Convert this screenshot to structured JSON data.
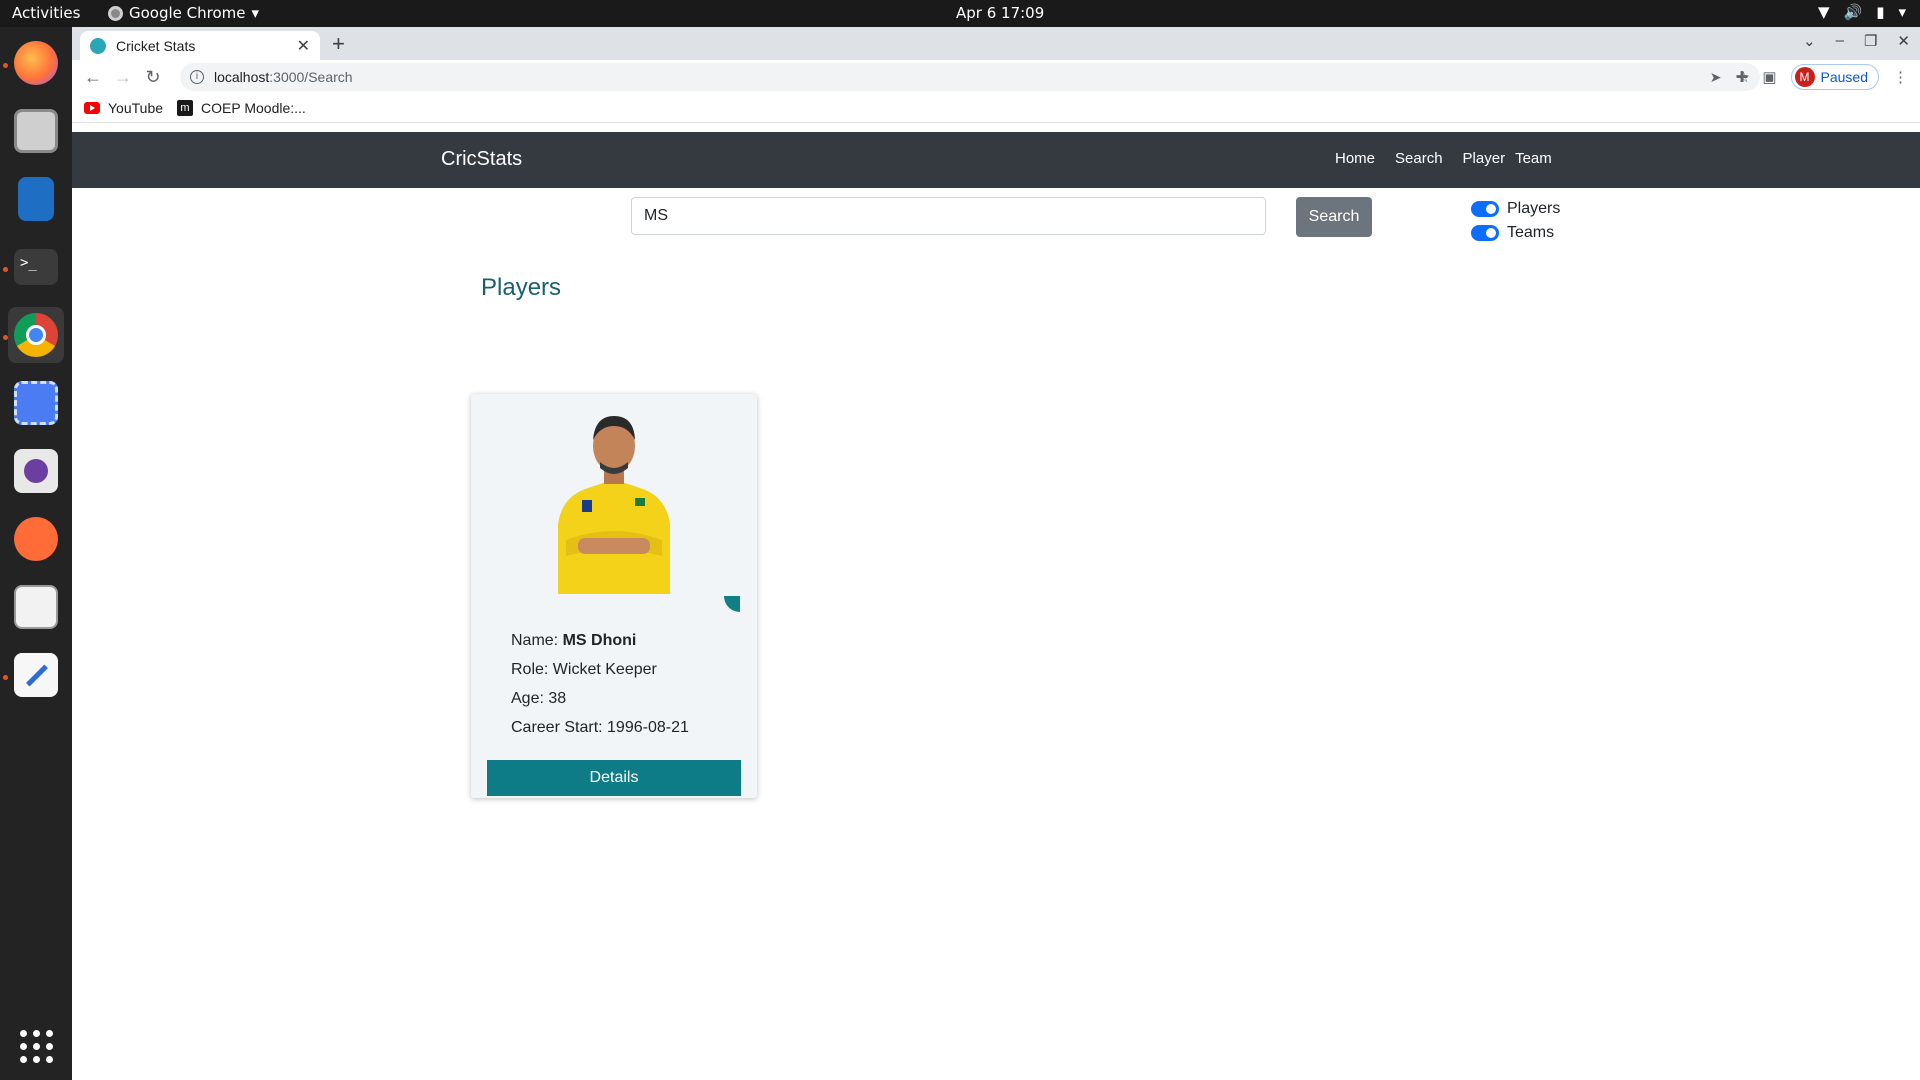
{
  "system": {
    "activities": "Activities",
    "app_menu": "Google Chrome",
    "clock": "Apr 6  17:09"
  },
  "browser": {
    "tab_title": "Cricket Stats",
    "url_host": "localhost",
    "url_path": ":3000/Search",
    "profile_initial": "M",
    "profile_status": "Paused",
    "bookmarks": [
      "YouTube",
      "COEP Moodle:..."
    ]
  },
  "app": {
    "brand": "CricStats",
    "nav": [
      "Home",
      "Search",
      "Player",
      "Team"
    ],
    "search": {
      "value": "MS",
      "button": "Search"
    },
    "filters": [
      {
        "label": "Players",
        "checked": true
      },
      {
        "label": "Teams",
        "checked": true
      }
    ],
    "section_title": "Players",
    "player_card": {
      "name_label": "Name:",
      "name": "MS Dhoni",
      "role": "Role: Wicket Keeper",
      "age": "Age: 38",
      "career": "Career Start: 1996-08-21",
      "button": "Details"
    }
  },
  "colors": {
    "navbar": "#343a40",
    "accent_teal": "#0e7c86",
    "title_blue": "#1a5e73",
    "toggle_blue": "#0d6efd"
  }
}
